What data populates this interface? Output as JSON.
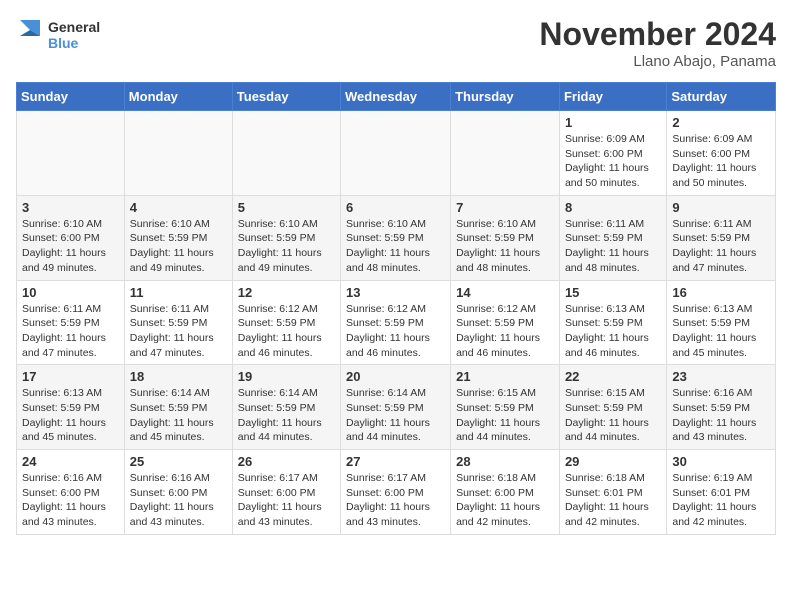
{
  "logo": {
    "general": "General",
    "blue": "Blue"
  },
  "title": "November 2024",
  "location": "Llano Abajo, Panama",
  "days_header": [
    "Sunday",
    "Monday",
    "Tuesday",
    "Wednesday",
    "Thursday",
    "Friday",
    "Saturday"
  ],
  "weeks": [
    [
      {
        "day": "",
        "info": ""
      },
      {
        "day": "",
        "info": ""
      },
      {
        "day": "",
        "info": ""
      },
      {
        "day": "",
        "info": ""
      },
      {
        "day": "",
        "info": ""
      },
      {
        "day": "1",
        "info": "Sunrise: 6:09 AM\nSunset: 6:00 PM\nDaylight: 11 hours\nand 50 minutes."
      },
      {
        "day": "2",
        "info": "Sunrise: 6:09 AM\nSunset: 6:00 PM\nDaylight: 11 hours\nand 50 minutes."
      }
    ],
    [
      {
        "day": "3",
        "info": "Sunrise: 6:10 AM\nSunset: 6:00 PM\nDaylight: 11 hours\nand 49 minutes."
      },
      {
        "day": "4",
        "info": "Sunrise: 6:10 AM\nSunset: 5:59 PM\nDaylight: 11 hours\nand 49 minutes."
      },
      {
        "day": "5",
        "info": "Sunrise: 6:10 AM\nSunset: 5:59 PM\nDaylight: 11 hours\nand 49 minutes."
      },
      {
        "day": "6",
        "info": "Sunrise: 6:10 AM\nSunset: 5:59 PM\nDaylight: 11 hours\nand 48 minutes."
      },
      {
        "day": "7",
        "info": "Sunrise: 6:10 AM\nSunset: 5:59 PM\nDaylight: 11 hours\nand 48 minutes."
      },
      {
        "day": "8",
        "info": "Sunrise: 6:11 AM\nSunset: 5:59 PM\nDaylight: 11 hours\nand 48 minutes."
      },
      {
        "day": "9",
        "info": "Sunrise: 6:11 AM\nSunset: 5:59 PM\nDaylight: 11 hours\nand 47 minutes."
      }
    ],
    [
      {
        "day": "10",
        "info": "Sunrise: 6:11 AM\nSunset: 5:59 PM\nDaylight: 11 hours\nand 47 minutes."
      },
      {
        "day": "11",
        "info": "Sunrise: 6:11 AM\nSunset: 5:59 PM\nDaylight: 11 hours\nand 47 minutes."
      },
      {
        "day": "12",
        "info": "Sunrise: 6:12 AM\nSunset: 5:59 PM\nDaylight: 11 hours\nand 46 minutes."
      },
      {
        "day": "13",
        "info": "Sunrise: 6:12 AM\nSunset: 5:59 PM\nDaylight: 11 hours\nand 46 minutes."
      },
      {
        "day": "14",
        "info": "Sunrise: 6:12 AM\nSunset: 5:59 PM\nDaylight: 11 hours\nand 46 minutes."
      },
      {
        "day": "15",
        "info": "Sunrise: 6:13 AM\nSunset: 5:59 PM\nDaylight: 11 hours\nand 46 minutes."
      },
      {
        "day": "16",
        "info": "Sunrise: 6:13 AM\nSunset: 5:59 PM\nDaylight: 11 hours\nand 45 minutes."
      }
    ],
    [
      {
        "day": "17",
        "info": "Sunrise: 6:13 AM\nSunset: 5:59 PM\nDaylight: 11 hours\nand 45 minutes."
      },
      {
        "day": "18",
        "info": "Sunrise: 6:14 AM\nSunset: 5:59 PM\nDaylight: 11 hours\nand 45 minutes."
      },
      {
        "day": "19",
        "info": "Sunrise: 6:14 AM\nSunset: 5:59 PM\nDaylight: 11 hours\nand 44 minutes."
      },
      {
        "day": "20",
        "info": "Sunrise: 6:14 AM\nSunset: 5:59 PM\nDaylight: 11 hours\nand 44 minutes."
      },
      {
        "day": "21",
        "info": "Sunrise: 6:15 AM\nSunset: 5:59 PM\nDaylight: 11 hours\nand 44 minutes."
      },
      {
        "day": "22",
        "info": "Sunrise: 6:15 AM\nSunset: 5:59 PM\nDaylight: 11 hours\nand 44 minutes."
      },
      {
        "day": "23",
        "info": "Sunrise: 6:16 AM\nSunset: 5:59 PM\nDaylight: 11 hours\nand 43 minutes."
      }
    ],
    [
      {
        "day": "24",
        "info": "Sunrise: 6:16 AM\nSunset: 6:00 PM\nDaylight: 11 hours\nand 43 minutes."
      },
      {
        "day": "25",
        "info": "Sunrise: 6:16 AM\nSunset: 6:00 PM\nDaylight: 11 hours\nand 43 minutes."
      },
      {
        "day": "26",
        "info": "Sunrise: 6:17 AM\nSunset: 6:00 PM\nDaylight: 11 hours\nand 43 minutes."
      },
      {
        "day": "27",
        "info": "Sunrise: 6:17 AM\nSunset: 6:00 PM\nDaylight: 11 hours\nand 43 minutes."
      },
      {
        "day": "28",
        "info": "Sunrise: 6:18 AM\nSunset: 6:00 PM\nDaylight: 11 hours\nand 42 minutes."
      },
      {
        "day": "29",
        "info": "Sunrise: 6:18 AM\nSunset: 6:01 PM\nDaylight: 11 hours\nand 42 minutes."
      },
      {
        "day": "30",
        "info": "Sunrise: 6:19 AM\nSunset: 6:01 PM\nDaylight: 11 hours\nand 42 minutes."
      }
    ]
  ]
}
